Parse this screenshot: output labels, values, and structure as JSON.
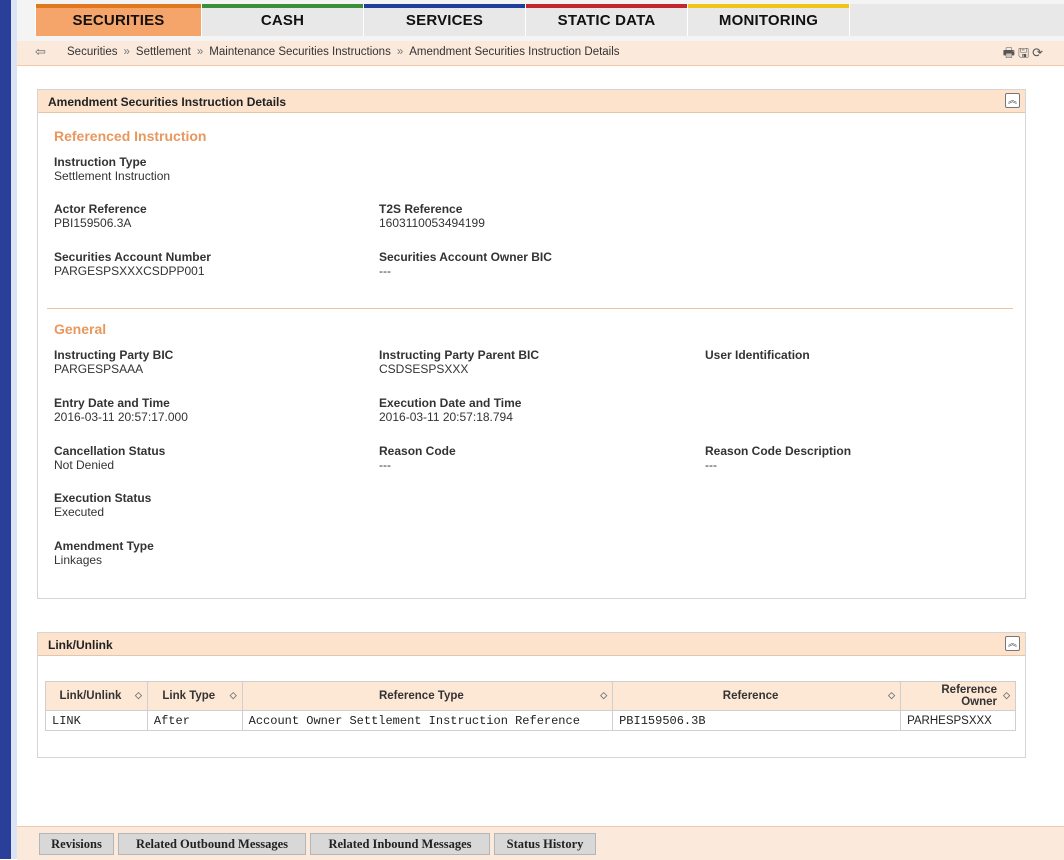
{
  "tabs": [
    {
      "label": "SECURITIES",
      "color": "#e0781f"
    },
    {
      "label": "CASH",
      "color": "#3a8f3a"
    },
    {
      "label": "SERVICES",
      "color": "#1f3f9a"
    },
    {
      "label": "STATIC DATA",
      "color": "#c2272d"
    },
    {
      "label": "MONITORING",
      "color": "#f0c419"
    }
  ],
  "breadcrumb": {
    "back_icon": "back-arrow-icon",
    "items": [
      "Securities",
      "Settlement",
      "Maintenance Securities Instructions",
      "Amendment Securities Instruction Details"
    ],
    "separator": "»"
  },
  "toolbar_icons": [
    "print-icon",
    "save-icon",
    "refresh-icon"
  ],
  "details_panel": {
    "title": "Amendment Securities Instruction Details",
    "referenced": {
      "section_title": "Referenced Instruction",
      "instruction_type": {
        "label": "Instruction Type",
        "value": "Settlement Instruction"
      },
      "actor_reference": {
        "label": "Actor Reference",
        "value": "PBI159506.3A"
      },
      "t2s_reference": {
        "label": "T2S Reference",
        "value": "1603110053494199"
      },
      "sec_account_number": {
        "label": "Securities Account Number",
        "value": "PARGESPSXXXCSDPP001"
      },
      "sec_account_owner_bic": {
        "label": "Securities Account Owner BIC",
        "value": "---"
      }
    },
    "general": {
      "section_title": "General",
      "instructing_party_bic": {
        "label": "Instructing Party BIC",
        "value": "PARGESPSAAA"
      },
      "instructing_party_parent_bic": {
        "label": "Instructing Party Parent BIC",
        "value": "CSDSESPSXXX"
      },
      "user_identification": {
        "label": "User Identification",
        "value": ""
      },
      "entry_date_time": {
        "label": "Entry Date and Time",
        "value": "2016-03-11 20:57:17.000"
      },
      "execution_date_time": {
        "label": "Execution Date and Time",
        "value": "2016-03-11 20:57:18.794"
      },
      "cancellation_status": {
        "label": "Cancellation Status",
        "value": "Not Denied"
      },
      "reason_code": {
        "label": "Reason Code",
        "value": "---"
      },
      "reason_code_description": {
        "label": "Reason Code Description",
        "value": "---"
      },
      "execution_status": {
        "label": "Execution Status",
        "value": "Executed"
      },
      "amendment_type": {
        "label": "Amendment Type",
        "value": "Linkages"
      }
    }
  },
  "link_panel": {
    "title": "Link/Unlink",
    "columns": [
      "Link/Unlink",
      "Link Type",
      "Reference Type",
      "Reference",
      "Reference Owner"
    ],
    "rows": [
      [
        "LINK",
        "After",
        "Account Owner Settlement Instruction Reference",
        "PBI159506.3B",
        "PARHESPSXXX"
      ]
    ]
  },
  "bottom_buttons": [
    "Revisions",
    "Related Outbound Messages",
    "Related Inbound Messages",
    "Status History"
  ]
}
